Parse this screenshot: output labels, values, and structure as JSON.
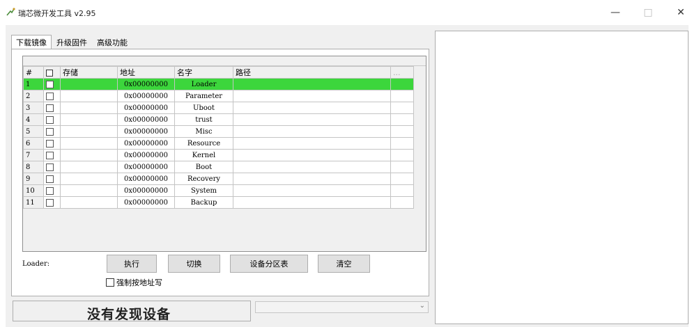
{
  "window": {
    "title": "瑞芯微开发工具 v2.95",
    "minimize_glyph": "—",
    "maximize_glyph": "□",
    "close_glyph": "✕"
  },
  "tabs": [
    {
      "label": "下载镜像",
      "active": true
    },
    {
      "label": "升级固件",
      "active": false
    },
    {
      "label": "高级功能",
      "active": false
    }
  ],
  "grid": {
    "headers": {
      "num": "#",
      "store": "存储",
      "addr": "地址",
      "name": "名字",
      "path": "路径",
      "browse": "..."
    },
    "rows": [
      {
        "num": "1",
        "store": "",
        "addr": "0x00000000",
        "name": "Loader",
        "path": "",
        "selected": true
      },
      {
        "num": "2",
        "store": "",
        "addr": "0x00000000",
        "name": "Parameter",
        "path": ""
      },
      {
        "num": "3",
        "store": "",
        "addr": "0x00000000",
        "name": "Uboot",
        "path": ""
      },
      {
        "num": "4",
        "store": "",
        "addr": "0x00000000",
        "name": "trust",
        "path": ""
      },
      {
        "num": "5",
        "store": "",
        "addr": "0x00000000",
        "name": "Misc",
        "path": ""
      },
      {
        "num": "6",
        "store": "",
        "addr": "0x00000000",
        "name": "Resource",
        "path": ""
      },
      {
        "num": "7",
        "store": "",
        "addr": "0x00000000",
        "name": "Kernel",
        "path": ""
      },
      {
        "num": "8",
        "store": "",
        "addr": "0x00000000",
        "name": "Boot",
        "path": ""
      },
      {
        "num": "9",
        "store": "",
        "addr": "0x00000000",
        "name": "Recovery",
        "path": ""
      },
      {
        "num": "10",
        "store": "",
        "addr": "0x00000000",
        "name": "System",
        "path": ""
      },
      {
        "num": "11",
        "store": "",
        "addr": "0x00000000",
        "name": "Backup",
        "path": ""
      }
    ],
    "selected_row_color": "#3cd63c"
  },
  "controls": {
    "loader_label": "Loader:",
    "exec_label": "执行",
    "switch_label": "切换",
    "device_partition_label": "设备分区表",
    "clear_label": "清空",
    "force_address_label": "强制按地址写"
  },
  "status": {
    "text": "没有发现设备"
  }
}
